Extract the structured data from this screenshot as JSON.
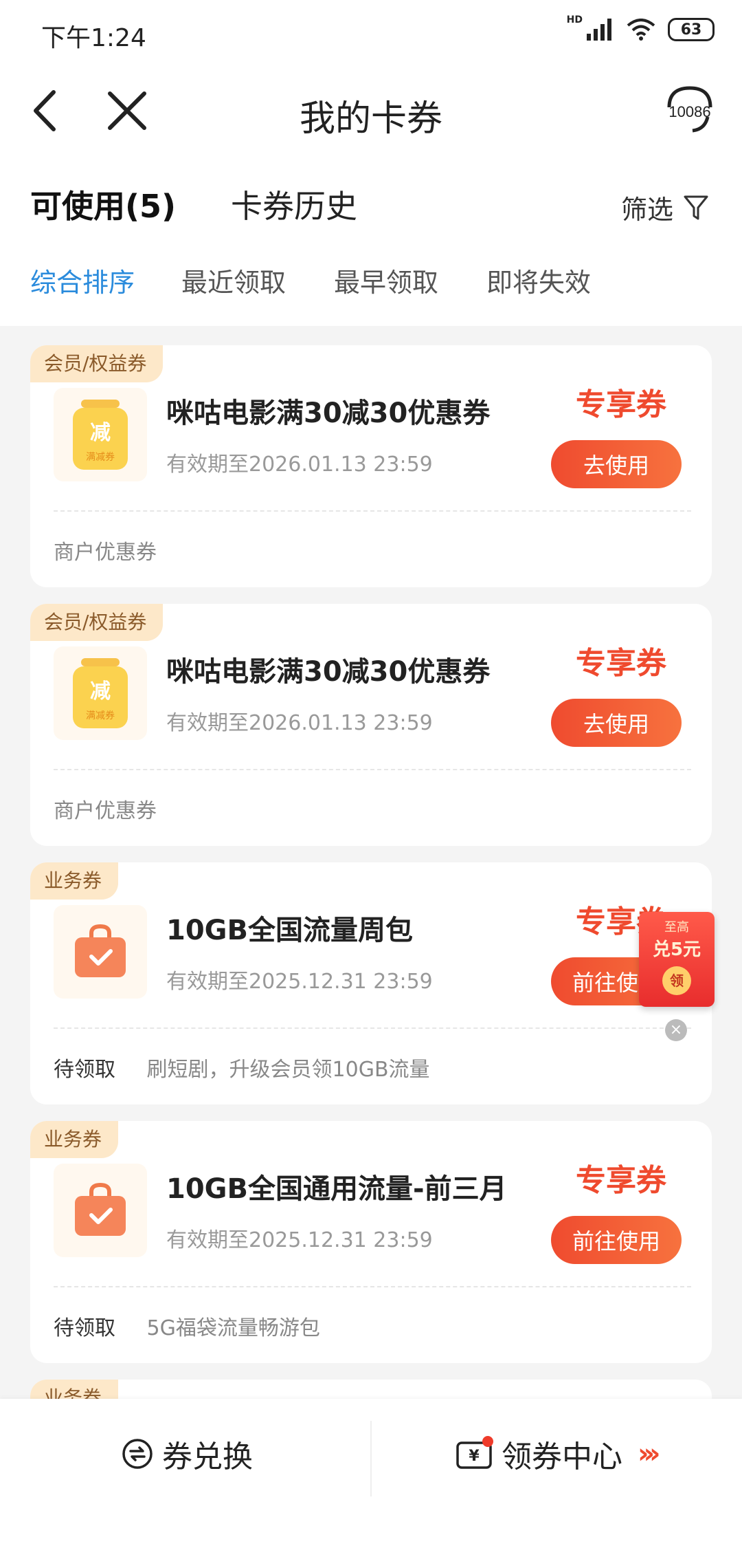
{
  "status_bar": {
    "time": "下午1:24",
    "signal_label": "HD",
    "battery": "63"
  },
  "header": {
    "title": "我的卡券",
    "service_label": "10086"
  },
  "tabs": {
    "available": "可使用(5)",
    "history": "卡券历史",
    "filter": "筛选"
  },
  "sort": [
    "综合排序",
    "最近领取",
    "最早领取",
    "即将失效"
  ],
  "cards": [
    {
      "tag": "会员/权益券",
      "name": "咪咕电影满30减30优惠券",
      "date": "有效期至2026.01.13 23:59",
      "exclusive": "专享券",
      "button": "去使用",
      "status": "",
      "footer": "商户优惠券",
      "thumb_main": "减",
      "thumb_sub": "满减券",
      "thumb_type": "jar"
    },
    {
      "tag": "会员/权益券",
      "name": "咪咕电影满30减30优惠券",
      "date": "有效期至2026.01.13 23:59",
      "exclusive": "专享券",
      "button": "去使用",
      "status": "",
      "footer": "商户优惠券",
      "thumb_main": "减",
      "thumb_sub": "满减券",
      "thumb_type": "jar"
    },
    {
      "tag": "业务券",
      "name": "10GB全国流量周包",
      "date": "有效期至2025.12.31 23:59",
      "exclusive": "专享券",
      "button": "前往使用",
      "status": "待领取",
      "footer": "刷短剧，升级会员领10GB流量",
      "thumb_type": "bag"
    },
    {
      "tag": "业务券",
      "name": "10GB全国通用流量-前三月",
      "date": "有效期至2025.12.31 23:59",
      "exclusive": "专享券",
      "button": "前往使用",
      "status": "待领取",
      "footer": "5G福袋流量畅游包",
      "thumb_type": "bag"
    },
    {
      "tag": "业务券"
    }
  ],
  "promo": {
    "line1": "至高",
    "line2": "兑5元",
    "coin": "领"
  },
  "bottom": {
    "exchange": "券兑换",
    "center": "领券中心"
  }
}
